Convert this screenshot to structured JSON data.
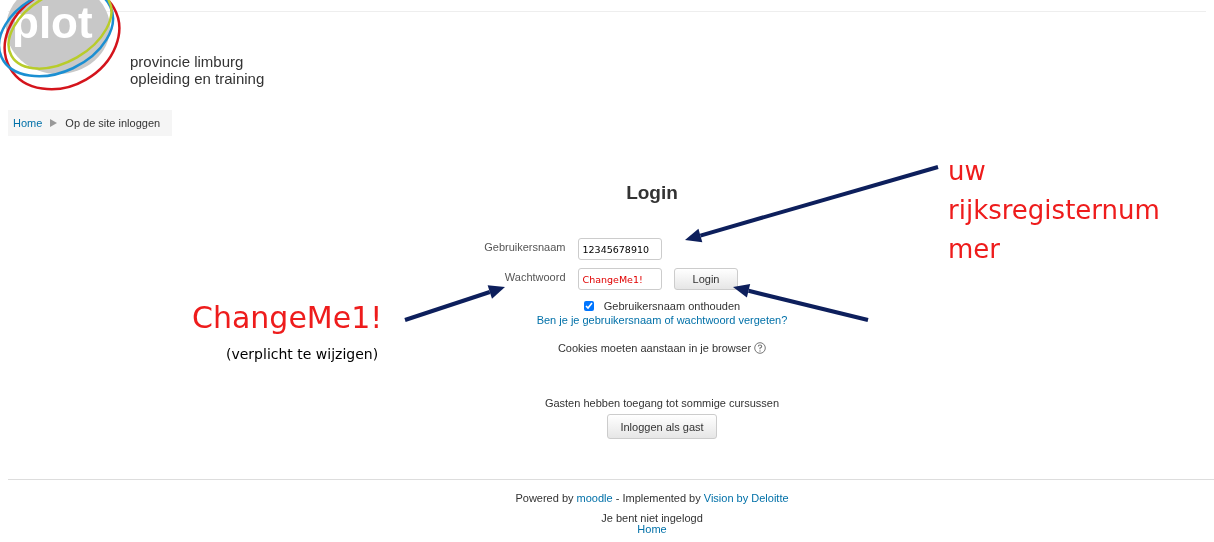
{
  "header": {
    "logo_text": "plot",
    "org_lines": [
      "provincie limburg",
      "opleiding en training"
    ]
  },
  "breadcrumb": [
    {
      "label": "Home",
      "kind": "link"
    },
    {
      "label": "Op de site inloggen",
      "kind": "current"
    }
  ],
  "login": {
    "title": "Login",
    "fields": [
      {
        "label": "Gebruikersnaam",
        "value": "12345678910",
        "highlighted": false
      },
      {
        "label": "Wachtwoord",
        "value": "ChangeMe1!",
        "highlighted": true
      }
    ],
    "submit": "Login",
    "remember": {
      "label": "Gebruikersnaam onthouden",
      "checked": true
    },
    "forgot_link": "Ben je je gebruikersnaam of wachtwoord vergeten?",
    "cookies_note": "Cookies moeten aanstaan in je browser",
    "guest_note": "Gasten hebben toegang tot sommige cursussen",
    "guest_button": "Inloggen als gast"
  },
  "footer": {
    "powered": [
      {
        "text": "Powered by ",
        "kind": "text"
      },
      {
        "text": "moodle",
        "kind": "link"
      },
      {
        "text": " - Implemented by ",
        "kind": "text"
      },
      {
        "text": "Vision by Deloitte",
        "kind": "link"
      }
    ],
    "status": "Je bent niet ingelogd",
    "home_link": "Home"
  },
  "annotations": {
    "username_note": [
      "uw",
      "rijksregisternum",
      "mer"
    ],
    "password_note": "ChangeMe1!",
    "password_subnote": "(verplicht te wijzigen)"
  }
}
